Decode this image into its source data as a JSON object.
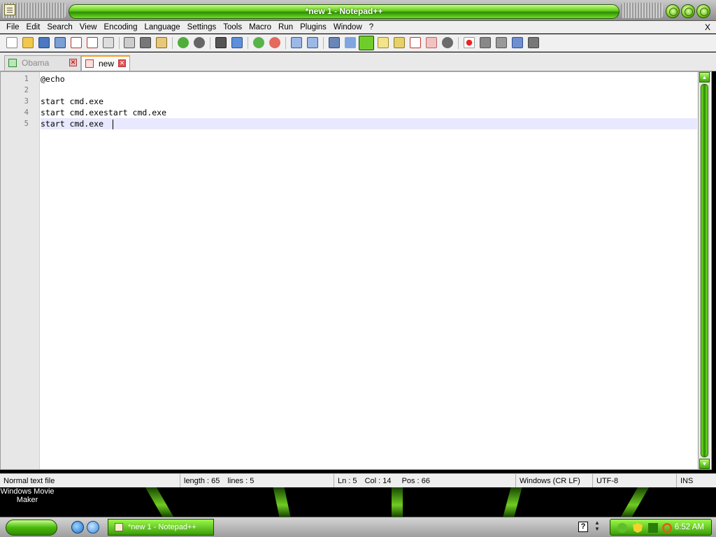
{
  "window": {
    "title": "*new 1 - Notepad++",
    "close_label": "X"
  },
  "menu": [
    "File",
    "Edit",
    "Search",
    "View",
    "Encoding",
    "Language",
    "Settings",
    "Tools",
    "Macro",
    "Run",
    "Plugins",
    "Window",
    "?"
  ],
  "tabs": [
    {
      "label": "Obama Theme",
      "active": false
    },
    {
      "label": "new 1",
      "active": true
    }
  ],
  "editor": {
    "lines": [
      {
        "num": "1",
        "text": "@echo"
      },
      {
        "num": "2",
        "text": ""
      },
      {
        "num": "3",
        "text": "start cmd.exe"
      },
      {
        "num": "4",
        "text": "start cmd.exestart cmd.exe"
      },
      {
        "num": "5",
        "text": "start cmd.exe"
      }
    ]
  },
  "status": {
    "type": "Normal text file",
    "length": "length : 65",
    "lines": "lines : 5",
    "ln": "Ln : 5",
    "col": "Col : 14",
    "pos": "Pos : 66",
    "eol": "Windows (CR LF)",
    "encoding": "UTF-8",
    "mode": "INS"
  },
  "desktop": {
    "icon_label": "Windows Movie Maker"
  },
  "taskbar": {
    "task_label": "*new 1 - Notepad++",
    "help": "?",
    "clock": "6:52 AM"
  },
  "colors": {
    "accent": "#5fcc16",
    "current_line": "#e8e8ff",
    "tab_highlight": "#f39c1a"
  }
}
